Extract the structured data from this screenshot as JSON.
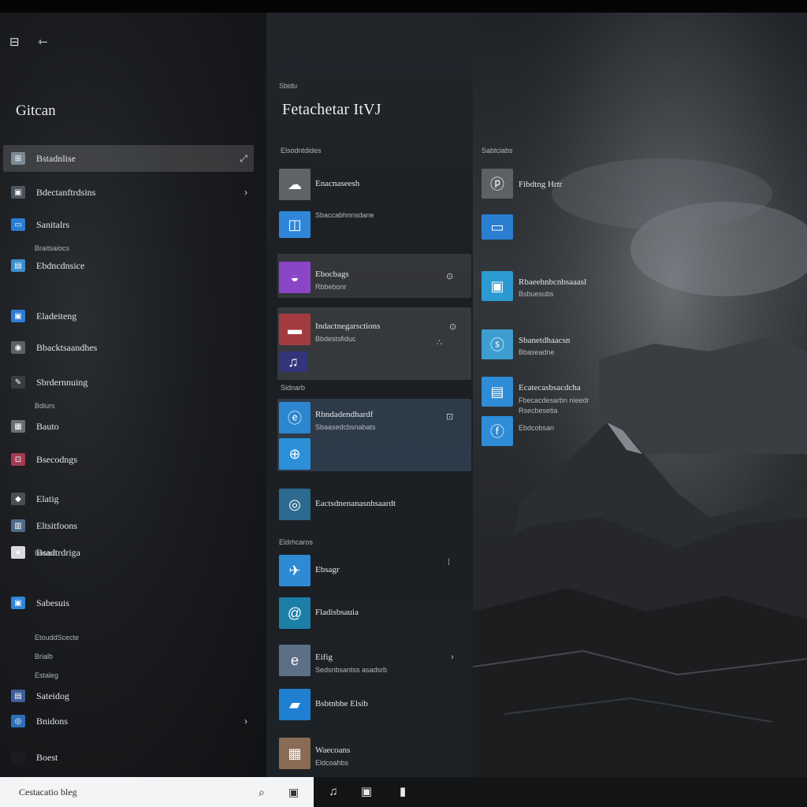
{
  "window": {
    "top_left_icons": [
      "⊟",
      "⇽"
    ],
    "left_title": "Gitcan",
    "mid_section_label": "Sbidu",
    "mid_title": "Fetachetar ItVJ",
    "pin_icon": "pin-icon"
  },
  "left_nav": [
    {
      "label": "Bstadnlise",
      "right": "⤢",
      "icon": "⊞",
      "color": "#7d8a95",
      "active": true
    },
    {
      "label": "Bdectanftrdsins",
      "right": "›",
      "icon": "▣",
      "color": "#4b5560"
    },
    {
      "label": "Sanitalrs",
      "right": "",
      "icon": "▭",
      "color": "#2b7cd3"
    },
    {
      "label": "Ebdncdnsice",
      "right": "",
      "icon": "▤",
      "color": "#3a8fd0"
    },
    {
      "label": "Eladeiteng",
      "right": "",
      "icon": "▣",
      "color": "#2d7bd6"
    },
    {
      "label": "Bbacktsaandhes",
      "right": "",
      "icon": "◉",
      "color": "#5a6168"
    },
    {
      "label": "Sbrdernnuing",
      "right": "",
      "icon": "✎",
      "color": "#3a3d40"
    },
    {
      "label": "Bauto",
      "right": "",
      "icon": "▦",
      "color": "#6b6f72"
    },
    {
      "label": "Bsecodngs",
      "right": "",
      "icon": "⊡",
      "color": "#a33a52"
    },
    {
      "label": "Elatig",
      "right": "",
      "icon": "◆",
      "color": "#4b4f53"
    },
    {
      "label": "Eltsitfoons",
      "right": "",
      "icon": "▥",
      "color": "#4e6b8a"
    },
    {
      "label": "Bsadtrdriga",
      "right": "",
      "icon": "●",
      "color": "#d9dadb"
    },
    {
      "label": "Sabesuis",
      "right": "",
      "icon": "▣",
      "color": "#2f86d8"
    },
    {
      "label": "Sateidog",
      "right": "",
      "icon": "▤",
      "color": "#3d5f99"
    },
    {
      "label": "Bnidons",
      "right": "›",
      "icon": "◎",
      "color": "#2e6fb8"
    },
    {
      "label": "Boest",
      "right": "",
      "icon": "",
      "color": "#1a1c1f"
    }
  ],
  "left_subs": [
    "Braitsaiocs",
    "Bdiurs",
    "Bootcd",
    "EtouddScecte",
    "Brialb",
    "Estaleg"
  ],
  "mid_groups": {
    "g1": "Elsodntdides",
    "g2": "Sidnarb",
    "g3": "Eldrhcaros"
  },
  "mid_items": [
    {
      "label": "Enacnaseesh",
      "sub": "",
      "icon": "☁",
      "color": "#5f6368"
    },
    {
      "label": "",
      "sub": "Sbaccabhnnsdane",
      "icon": "◫",
      "color": "#2f86d8"
    },
    {
      "label": "Ebocbags",
      "sub": "Rbbebonr",
      "icon": "◒",
      "color": "#8b46c8"
    },
    {
      "label": "Indactnegarsctions",
      "sub": "Bbdestsfiduc",
      "icon": "▬",
      "color": "#a33b40"
    },
    {
      "label": "",
      "sub": "",
      "icon": "♫",
      "color": "#33357a"
    },
    {
      "label": "Rbndadendhardf",
      "sub": "Sbaasedcbsnabats",
      "icon": "ⓔ",
      "color": "#2c86d0"
    },
    {
      "label": "",
      "sub": "",
      "icon": "⊕",
      "color": "#2c8fd8"
    },
    {
      "label": "Eactsdnenanasnhsaardt",
      "sub": "",
      "icon": "◎",
      "color": "#2d6a90"
    },
    {
      "label": "Ebsagr",
      "sub": "",
      "icon": "✈",
      "color": "#2f8ad4"
    },
    {
      "label": "Fladisbsauia",
      "sub": "",
      "icon": "@",
      "color": "#1d7fa8"
    },
    {
      "label": "Eifig",
      "sub": "Sedsnbsantss asadsrb",
      "icon": "e",
      "color": "#5d6f86"
    },
    {
      "label": "Bsbtnbbe Elsib",
      "sub": "",
      "icon": "▰",
      "color": "#1f7fd0"
    },
    {
      "label": "Waecoans",
      "sub": "Eldcoahbs",
      "icon": "▦",
      "color": "#8a6b55"
    }
  ],
  "right_group": "Sabtciabs",
  "right_items": [
    {
      "label": "Fibdtng Hrtr",
      "sub": "",
      "icon": "ⓟ",
      "color": "#5d6064"
    },
    {
      "label": "",
      "sub": "",
      "icon": "▭",
      "color": "#2a7fd3"
    },
    {
      "label": "Rbaeehnbcnbsaaasl",
      "sub": "Bsbuesubs",
      "icon": "▣",
      "color": "#2b9ad2"
    },
    {
      "label": "Sbanetdhaacsn",
      "sub": "Bbaseadne",
      "icon": "ⓢ",
      "color": "#3d9dd0"
    },
    {
      "label": "Ecatecasbsacdcha",
      "sub": "Fbecacdesarbn nieedr Rsecbesetia",
      "icon": "▤",
      "color": "#2f8cd6"
    },
    {
      "label": "",
      "sub": "Ebdcobsan",
      "icon": "ⓕ",
      "color": "#2f8cd6"
    }
  ],
  "taskbar": {
    "search_text": "Cestacatio bleg",
    "search_icons": [
      "⌕",
      "▣"
    ],
    "tray_icons": [
      "♫",
      "▣",
      "▮"
    ]
  }
}
